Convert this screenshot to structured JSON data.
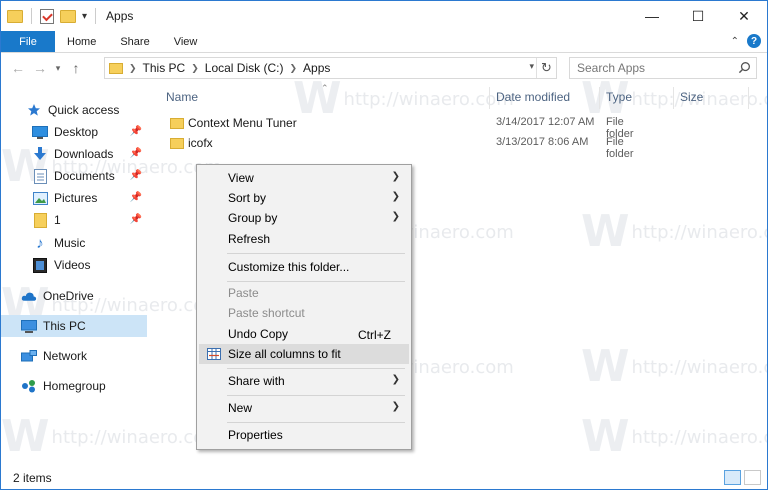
{
  "window": {
    "title": "Apps",
    "controls": {
      "minimize": "—",
      "maximize": "☐",
      "close": "✕"
    }
  },
  "ribbon": {
    "tabs": [
      "File",
      "Home",
      "Share",
      "View"
    ],
    "collapse_glyph": "⌃",
    "help_glyph": "?"
  },
  "address": {
    "crumbs": [
      "This PC",
      "Local Disk (C:)",
      "Apps"
    ],
    "search_placeholder": "Search Apps"
  },
  "sidebar": {
    "items": [
      {
        "label": "Quick access",
        "icon": "star-icon",
        "pinned": false
      },
      {
        "label": "Desktop",
        "icon": "desktop-icon",
        "pinned": true
      },
      {
        "label": "Downloads",
        "icon": "download-icon",
        "pinned": true
      },
      {
        "label": "Documents",
        "icon": "documents-icon",
        "pinned": true
      },
      {
        "label": "Pictures",
        "icon": "pictures-icon",
        "pinned": true
      },
      {
        "label": "1",
        "icon": "folder-icon",
        "pinned": true
      },
      {
        "label": "Music",
        "icon": "music-icon",
        "pinned": false
      },
      {
        "label": "Videos",
        "icon": "videos-icon",
        "pinned": false
      },
      {
        "label": "OneDrive",
        "icon": "cloud-icon",
        "pinned": false
      },
      {
        "label": "This PC",
        "icon": "computer-icon",
        "pinned": false
      },
      {
        "label": "Network",
        "icon": "network-icon",
        "pinned": false
      },
      {
        "label": "Homegroup",
        "icon": "homegroup-icon",
        "pinned": false
      }
    ]
  },
  "columns": [
    "Name",
    "Date modified",
    "Type",
    "Size"
  ],
  "files": [
    {
      "name": "Context Menu Tuner",
      "date": "3/14/2017 12:07 AM",
      "type": "File folder"
    },
    {
      "name": "icofx",
      "date": "3/13/2017 8:06 AM",
      "type": "File folder"
    }
  ],
  "context_menu": {
    "items": [
      {
        "label": "View",
        "submenu": true
      },
      {
        "label": "Sort by",
        "submenu": true
      },
      {
        "label": "Group by",
        "submenu": true
      },
      {
        "label": "Refresh"
      },
      {
        "label": "Customize this folder..."
      },
      {
        "label": "Paste",
        "disabled": true
      },
      {
        "label": "Paste shortcut",
        "disabled": true
      },
      {
        "label": "Undo Copy",
        "shortcut": "Ctrl+Z"
      },
      {
        "label": "Size all columns to fit",
        "highlighted": true
      },
      {
        "label": "Share with",
        "submenu": true
      },
      {
        "label": "New",
        "submenu": true
      },
      {
        "label": "Properties"
      }
    ],
    "submenu_glyph": "❯"
  },
  "status": {
    "item_count": "2 items"
  },
  "watermark": {
    "text": "http://winaero.com",
    "letter": "W"
  },
  "colors": {
    "accent": "#1979ca",
    "selected": "#cce4f7",
    "menu_bg": "#f2f2f2",
    "folder": "#f6cf5b"
  }
}
